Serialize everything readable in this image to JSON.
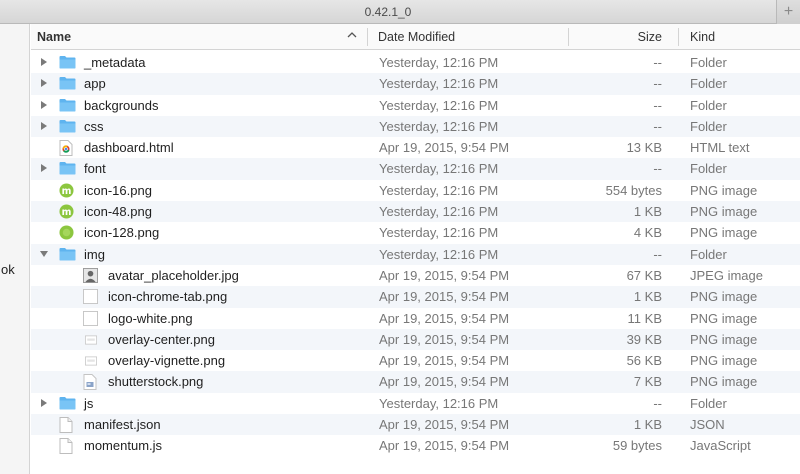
{
  "window": {
    "tab_title": "0.42.1_0",
    "new_tab_symbol": "+"
  },
  "sidebar": {
    "fragment_text": "ok"
  },
  "columns": {
    "name": "Name",
    "date": "Date Modified",
    "size": "Size",
    "kind": "Kind",
    "sort_indicator": "^"
  },
  "colors": {
    "folder": "#5fb4ef",
    "stripe": "#f3f6fa",
    "momentum_green": "#8cc63f"
  },
  "rows": [
    {
      "name": "_metadata",
      "date": "Yesterday, 12:16 PM",
      "size": "--",
      "kind": "Folder",
      "icon": "folder-icon",
      "indent": 0,
      "disclosure": "collapsed"
    },
    {
      "name": "app",
      "date": "Yesterday, 12:16 PM",
      "size": "--",
      "kind": "Folder",
      "icon": "folder-icon",
      "indent": 0,
      "disclosure": "collapsed"
    },
    {
      "name": "backgrounds",
      "date": "Yesterday, 12:16 PM",
      "size": "--",
      "kind": "Folder",
      "icon": "folder-icon",
      "indent": 0,
      "disclosure": "collapsed"
    },
    {
      "name": "css",
      "date": "Yesterday, 12:16 PM",
      "size": "--",
      "kind": "Folder",
      "icon": "folder-icon",
      "indent": 0,
      "disclosure": "collapsed"
    },
    {
      "name": "dashboard.html",
      "date": "Apr 19, 2015, 9:54 PM",
      "size": "13 KB",
      "kind": "HTML text",
      "icon": "chrome-html-file-icon",
      "indent": 0,
      "disclosure": "none"
    },
    {
      "name": "font",
      "date": "Yesterday, 12:16 PM",
      "size": "--",
      "kind": "Folder",
      "icon": "folder-icon",
      "indent": 0,
      "disclosure": "collapsed"
    },
    {
      "name": "icon-16.png",
      "date": "Yesterday, 12:16 PM",
      "size": "554 bytes",
      "kind": "PNG image",
      "icon": "momentum-m-icon",
      "indent": 0,
      "disclosure": "none"
    },
    {
      "name": "icon-48.png",
      "date": "Yesterday, 12:16 PM",
      "size": "1 KB",
      "kind": "PNG image",
      "icon": "momentum-m-icon",
      "indent": 0,
      "disclosure": "none"
    },
    {
      "name": "icon-128.png",
      "date": "Yesterday, 12:16 PM",
      "size": "4 KB",
      "kind": "PNG image",
      "icon": "green-circle-icon",
      "indent": 0,
      "disclosure": "none"
    },
    {
      "name": "img",
      "date": "Yesterday, 12:16 PM",
      "size": "--",
      "kind": "Folder",
      "icon": "folder-icon",
      "indent": 0,
      "disclosure": "expanded"
    },
    {
      "name": "avatar_placeholder.jpg",
      "date": "Apr 19, 2015, 9:54 PM",
      "size": "67 KB",
      "kind": "JPEG image",
      "icon": "avatar-image-icon",
      "indent": 1,
      "disclosure": "none"
    },
    {
      "name": "icon-chrome-tab.png",
      "date": "Apr 19, 2015, 9:54 PM",
      "size": "1 KB",
      "kind": "PNG image",
      "icon": "blank-image-icon",
      "indent": 1,
      "disclosure": "none"
    },
    {
      "name": "logo-white.png",
      "date": "Apr 19, 2015, 9:54 PM",
      "size": "11 KB",
      "kind": "PNG image",
      "icon": "blank-image-icon",
      "indent": 1,
      "disclosure": "none"
    },
    {
      "name": "overlay-center.png",
      "date": "Apr 19, 2015, 9:54 PM",
      "size": "39 KB",
      "kind": "PNG image",
      "icon": "landscape-image-icon",
      "indent": 1,
      "disclosure": "none"
    },
    {
      "name": "overlay-vignette.png",
      "date": "Apr 19, 2015, 9:54 PM",
      "size": "56 KB",
      "kind": "PNG image",
      "icon": "landscape-image-icon",
      "indent": 1,
      "disclosure": "none"
    },
    {
      "name": "shutterstock.png",
      "date": "Apr 19, 2015, 9:54 PM",
      "size": "7 KB",
      "kind": "PNG image",
      "icon": "small-image-icon",
      "indent": 1,
      "disclosure": "none"
    },
    {
      "name": "js",
      "date": "Yesterday, 12:16 PM",
      "size": "--",
      "kind": "Folder",
      "icon": "folder-icon",
      "indent": 0,
      "disclosure": "collapsed"
    },
    {
      "name": "manifest.json",
      "date": "Apr 19, 2015, 9:54 PM",
      "size": "1 KB",
      "kind": "JSON",
      "icon": "document-icon",
      "indent": 0,
      "disclosure": "none"
    },
    {
      "name": "momentum.js",
      "date": "Apr 19, 2015, 9:54 PM",
      "size": "59 bytes",
      "kind": "JavaScript",
      "icon": "document-icon",
      "indent": 0,
      "disclosure": "none"
    }
  ]
}
